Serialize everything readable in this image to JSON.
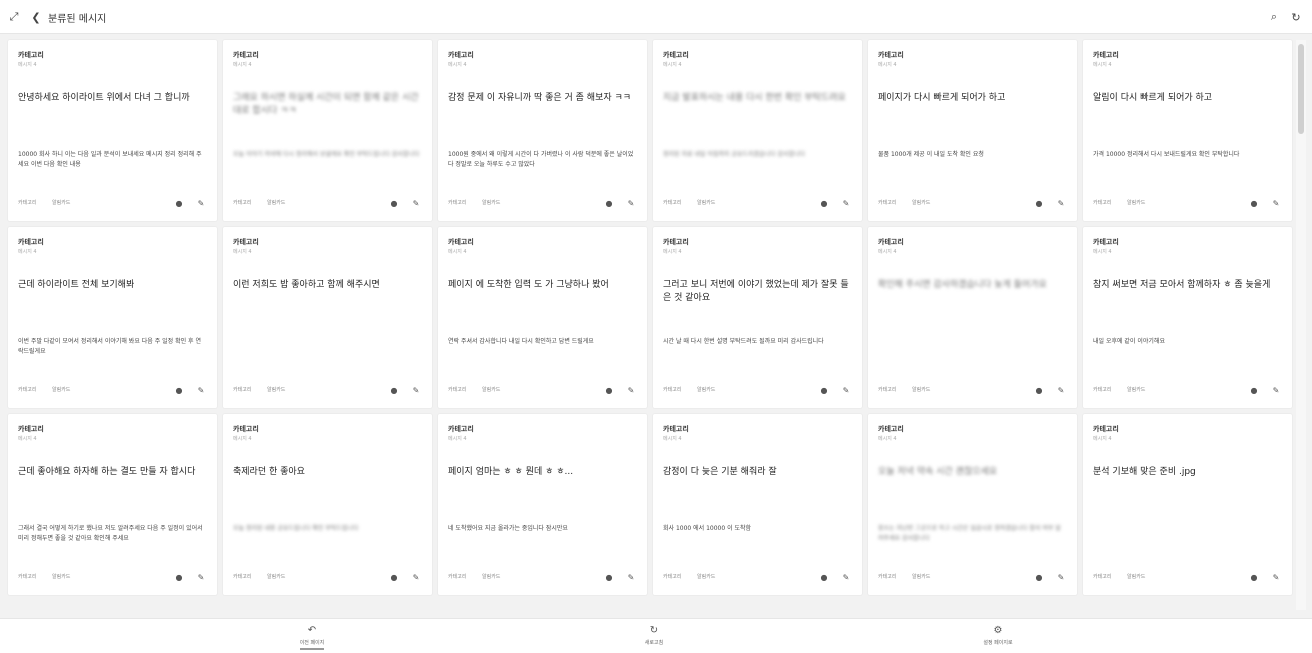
{
  "topbar": {
    "title": "분류된 메시지",
    "icons": [
      "expand-icon",
      "back-icon",
      "search-icon",
      "refresh-icon"
    ]
  },
  "cards": [
    {
      "category": "카테고리",
      "subtitle": "메시지 4",
      "title": "안녕하세요 하이라이트 위에서 다녀 그 합니까",
      "meta": "",
      "body": "10000 회사 하니 이는 다음 일과 분석이 보내세요 메시지 정리 정리해 주세요 이번 다음 확인 내용",
      "blur_title": false,
      "blur_body": false,
      "left": "카테고리",
      "right": "알림카드"
    },
    {
      "category": "카테고리",
      "subtitle": "메시지 4",
      "title": "그래요 하시면 하실께 시간이 되면 함께 같은 시간대로 합시다 ㅋㅋ",
      "meta": "",
      "body": "오늘 이야기 저녁에 다시 정리해서 보낼게요 확인 부탁드립니다 감사합니다",
      "blur_title": true,
      "blur_body": true,
      "left": "카테고리",
      "right": "알림카드"
    },
    {
      "category": "카테고리",
      "subtitle": "메시지 4",
      "title": "감정 문제 이 자유니까 딱 좋은 거 좀 해보자 ㅋㅋ",
      "meta": "",
      "body": "1000원 중에서 왜 이렇게 시간이 다 가버렸나 이 사람 덕분에 좋은 날이었다 정말로 오늘 하루도 수고 많았다",
      "blur_title": false,
      "blur_body": false,
      "left": "카테고리",
      "right": "알림카드"
    },
    {
      "category": "카테고리",
      "subtitle": "메시지 4",
      "title": "지금 발표하시는 내용 다시 한번 확인 부탁드려요",
      "meta": "",
      "body": "정리된 자료 내일 아침까지 공유드리겠습니다 감사합니다",
      "blur_title": true,
      "blur_body": true,
      "left": "카테고리",
      "right": "알림카드"
    },
    {
      "category": "카테고리",
      "subtitle": "메시지 4",
      "title": "페이지가 다시 빠르게 되어가 하고",
      "meta": "",
      "body": "물품 1000개 제공 이 내일 도착 확인 요청",
      "blur_title": false,
      "blur_body": false,
      "left": "카테고리",
      "right": "알림카드"
    },
    {
      "category": "카테고리",
      "subtitle": "메시지 4",
      "title": "알림이 다시 빠르게 되어가 하고",
      "meta": "",
      "body": "가격 10000 정리해서 다시 보내드릴게요 확인 부탁합니다",
      "blur_title": false,
      "blur_body": false,
      "left": "카테고리",
      "right": "알림카드"
    },
    {
      "category": "카테고리",
      "subtitle": "메시지 4",
      "title": "근데 하이라이트 전체 보기해봐",
      "meta": "",
      "body": "이번 주말 다같이 모여서 정리해서 이야기해 봐요 다음 주 일정 확인 후 연락드릴게요",
      "blur_title": false,
      "blur_body": false,
      "left": "카테고리",
      "right": "알림카드"
    },
    {
      "category": "카테고리",
      "subtitle": "메시지 4",
      "title": "이런 저희도 밥 좋아하고 함께 해주시면",
      "meta": "",
      "body": "",
      "blur_title": false,
      "blur_body": false,
      "left": "카테고리",
      "right": "알림카드"
    },
    {
      "category": "카테고리",
      "subtitle": "메시지 4",
      "title": "페이지 에 도착한 입력 도 가 그냥하나 봤어",
      "meta": "",
      "body": "연락 주셔서 감사합니다 내일 다시 확인하고 답변 드릴게요",
      "blur_title": false,
      "blur_body": false,
      "left": "카테고리",
      "right": "알림카드"
    },
    {
      "category": "카테고리",
      "subtitle": "메시지 4",
      "title": "그러고 보니 저번에 이야기 했었는데 제가 잘못 들은 것 같아요",
      "meta": "",
      "body": "시간 날 때 다시 한번 설명 부탁드려도 될까요 미리 감사드립니다",
      "blur_title": false,
      "blur_body": false,
      "left": "카테고리",
      "right": "알림카드"
    },
    {
      "category": "카테고리",
      "subtitle": "메시지 4",
      "title": "확인해 주시면 감사하겠습니다 늦게 들어가요",
      "meta": "",
      "body": "",
      "blur_title": true,
      "blur_body": false,
      "left": "카테고리",
      "right": "알림카드"
    },
    {
      "category": "카테고리",
      "subtitle": "메시지 4",
      "title": "참지 써보면 저금 모아서 함께하자 ㅎ 좀 늦을게",
      "meta": "",
      "body": "내일 오후에 같이 이야기해요",
      "blur_title": false,
      "blur_body": false,
      "left": "카테고리",
      "right": "알림카드"
    },
    {
      "category": "카테고리",
      "subtitle": "메시지 4",
      "title": "근데 좋아해요 하자해 하는 결도 만들 자 합시다",
      "meta": "",
      "body": "그래서 결국 어떻게 하기로 했나요 저도 알려주세요 다음 주 일정이 있어서 미리 정해두면 좋을 것 같아요 확인해 주세요",
      "blur_title": false,
      "blur_body": false,
      "left": "카테고리",
      "right": "알림카드"
    },
    {
      "category": "카테고리",
      "subtitle": "메시지 4",
      "title": "축제라던 한 좋아요",
      "meta": "",
      "body": "오늘 정리된 내용 공유드립니다 확인 부탁드립니다",
      "blur_title": false,
      "blur_body": true,
      "left": "카테고리",
      "right": "알림카드"
    },
    {
      "category": "카테고리",
      "subtitle": "메시지 4",
      "title": "페이지 엄마는 ㅎ ㅎ 뭔데 ㅎ ㅎ...",
      "meta": "",
      "body": "네 도착했어요 지금 올라가는 중입니다 잠시만요",
      "blur_title": false,
      "blur_body": false,
      "left": "카테고리",
      "right": "알림카드"
    },
    {
      "category": "카테고리",
      "subtitle": "메시지 4",
      "title": "감정이 다 늦은 기분 해줘라 잘",
      "meta": "",
      "body": "회사 1000 에서 10000 이 도착함",
      "blur_title": false,
      "blur_body": false,
      "left": "카테고리",
      "right": "알림카드"
    },
    {
      "category": "카테고리",
      "subtitle": "메시지 4",
      "title": "오늘 저녁 약속 시간 괜찮으세요",
      "meta": "",
      "body": "장소는 지난번 그곳으로 하고 시간은 일곱시로 정하겠습니다 참석 여부 알려주세요 감사합니다",
      "blur_title": true,
      "blur_body": true,
      "left": "카테고리",
      "right": "알림카드"
    },
    {
      "category": "카테고리",
      "subtitle": "메시지 4",
      "title": "분석 기보해 맞은 준비 .jpg",
      "meta": "",
      "body": "",
      "blur_title": false,
      "blur_body": false,
      "left": "카테고리",
      "right": "알림카드"
    }
  ],
  "bottom_nav": [
    {
      "icon": "back-arrow-icon",
      "label": "이전 페이지"
    },
    {
      "icon": "refresh-icon",
      "label": "새로고침"
    },
    {
      "icon": "settings-icon",
      "label": "설정 페이지로"
    }
  ]
}
